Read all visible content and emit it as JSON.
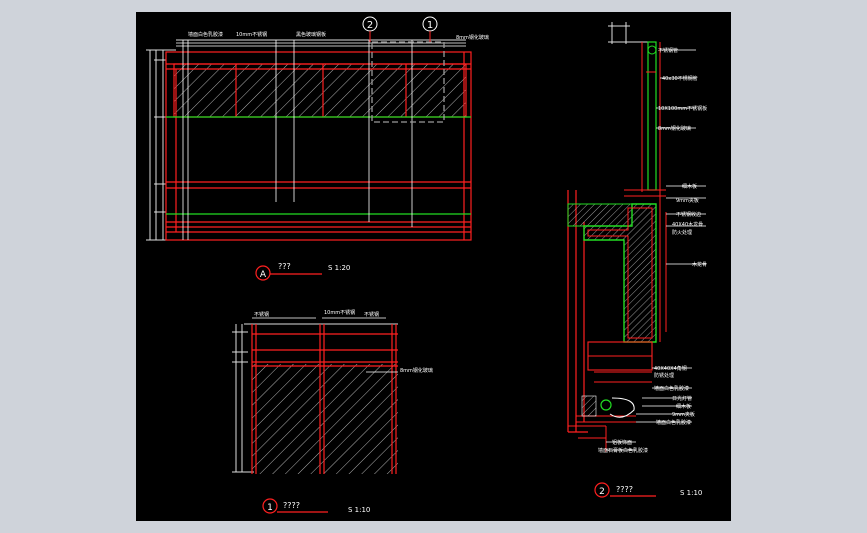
{
  "colors": {
    "viewport_bg": "#cfd3da",
    "canvas_bg": "#000000",
    "line_white": "#ffffff",
    "line_red": "#ff2020",
    "line_green": "#22dd22",
    "hatch_gray": "#b0b0b0"
  },
  "drawing": {
    "elevation_a": {
      "marker": "A",
      "title": "???",
      "scale": "S 1:20",
      "section_marker_1": "1",
      "section_marker_2": "2",
      "annotations": [
        "墙面白色乳胶漆",
        "10mm不锈钢",
        "黑色玻璃钢板",
        "8mm钢化玻璃"
      ]
    },
    "detail_1": {
      "marker": "1",
      "title": "????",
      "scale": "S 1:10",
      "annotations": [
        "不锈钢",
        "10mm不锈钢",
        "不锈钢",
        "8mm钢化玻璃"
      ]
    },
    "detail_2": {
      "marker": "2",
      "title": "????",
      "scale": "S 1:10",
      "annotations": [
        "不锈钢管",
        "40x30不锈钢管",
        "10X100mm不锈钢板",
        "8mm钢化玻璃",
        "细木板",
        "9mm夹板",
        "不锈钢收边",
        "40X40木龙骨",
        "防火处理",
        "木龙骨",
        "40X40X4角钢",
        "防锈处理",
        "墙面白色乳胶漆",
        "日光灯管",
        "细木板",
        "9mm夹板",
        "墙面白色乳胶漆",
        "铝板饰面",
        "墙面石膏板白色乳胶漆"
      ]
    }
  }
}
